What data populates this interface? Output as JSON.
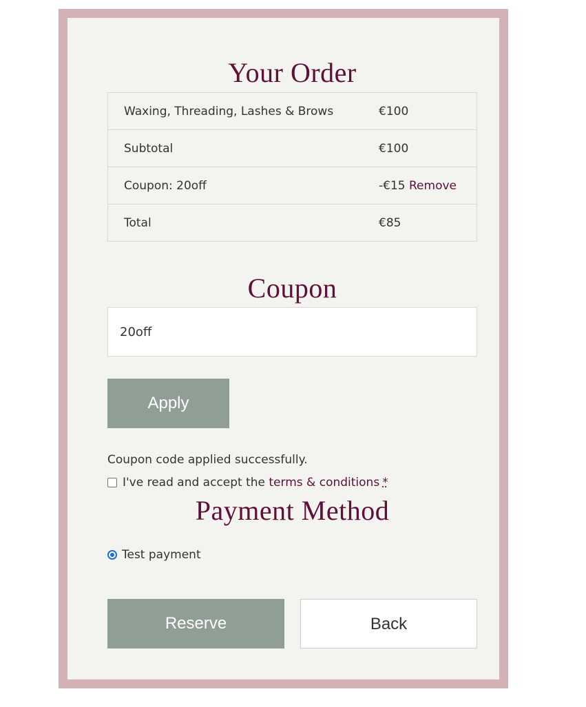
{
  "order": {
    "title": "Your Order",
    "rows": [
      {
        "label": "Waxing, Threading, Lashes & Brows",
        "value": "€100"
      },
      {
        "label": "Subtotal",
        "value": "€100"
      },
      {
        "label": "Coupon: 20off",
        "value": "-€15",
        "action": "Remove"
      },
      {
        "label": "Total",
        "value": "€85"
      }
    ]
  },
  "coupon": {
    "title": "Coupon",
    "value": "20off",
    "apply_label": "Apply",
    "message": "Coupon code applied successfully."
  },
  "terms": {
    "prefix": "I've read and accept the",
    "link": "terms & conditions",
    "required": "*"
  },
  "payment": {
    "title": "Payment Method",
    "option": "Test payment"
  },
  "actions": {
    "reserve": "Reserve",
    "back": "Back"
  },
  "colors": {
    "frame": "#d3b1b5",
    "accent": "#5e1038",
    "button": "#8f9f96",
    "background": "#f3f3ef"
  }
}
